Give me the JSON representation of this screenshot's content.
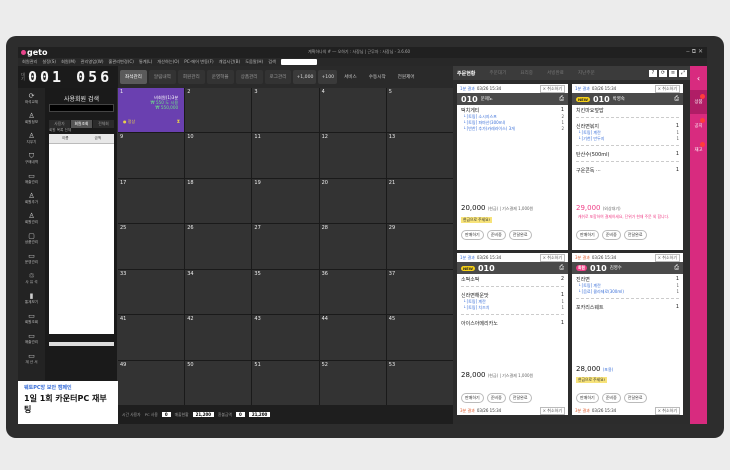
{
  "app": {
    "logo": "geto",
    "title": "계획하나의 # ― 오하기 : 사장님 | 근무자 : 사장님 - 3.6.60",
    "window_controls": "‒ ⧉ ✕"
  },
  "menu": [
    "회원관리",
    "설정(S)",
    "회원(M)",
    "관리영업(W)",
    "홀관리변경(C)",
    "통계(L)",
    "개산하는(O)",
    "PC-에어 변동(F)",
    "개업시간(B)",
    "도움말(H)",
    "검색"
  ],
  "counter": {
    "label": "대기",
    "value": "001 056"
  },
  "toolbar": {
    "tabs": [
      "좌석관리",
      "알림내역",
      "회원관리",
      "운영혁율",
      "상품관리",
      "로그관리"
    ],
    "buttons": [
      "+1,000",
      "+100",
      "서비스",
      "수동시작",
      "전원제어"
    ]
  },
  "nav": [
    {
      "label": "좌석교체",
      "icon": "⟳"
    },
    {
      "label": "회원정보",
      "icon": "♙"
    },
    {
      "label": "지우기",
      "icon": "♙"
    },
    {
      "label": "구매내역",
      "icon": "⛉"
    },
    {
      "label": "매출관리",
      "icon": "▭"
    },
    {
      "label": "회원추가",
      "icon": "♙"
    },
    {
      "label": "회원관리",
      "icon": "♙"
    },
    {
      "label": "상품관리",
      "icon": "▢"
    },
    {
      "label": "운영관리",
      "icon": "▭"
    },
    {
      "label": "사 유 석",
      "icon": "♲"
    },
    {
      "label": "통계보기",
      "icon": "▮"
    },
    {
      "label": "회원조회",
      "icon": "▭"
    },
    {
      "label": "매출관리",
      "icon": "▭"
    },
    {
      "label": "계 산 서",
      "icon": "▭"
    },
    {
      "label": "환경설정",
      "icon": "☼"
    }
  ],
  "member": {
    "title": "사용회원 검색",
    "tabs": [
      "사용자",
      "회원조회",
      "전체회"
    ],
    "sub": "회원 목록 전체",
    "columns": [
      "이름",
      "금액"
    ]
  },
  "promo": {
    "top": "웨토PC방 보안 캠페인",
    "main": "1일 1회 카운터PC 재부팅"
  },
  "grid": {
    "active": {
      "num": "1",
      "lines": [
        "비회원(1)3분",
        "₩ 550 도 시용",
        "₩ 550,000"
      ],
      "footer_left": "● 정상",
      "footer_right": "⧗"
    },
    "cells": [
      "2",
      "3",
      "4",
      "5",
      "9",
      "10",
      "11",
      "12",
      "13",
      "17",
      "18",
      "19",
      "20",
      "21",
      "25",
      "26",
      "27",
      "28",
      "29",
      "33",
      "34",
      "35",
      "36",
      "37",
      "41",
      "42",
      "43",
      "44",
      "45",
      "49",
      "50",
      "51",
      "52",
      "53"
    ]
  },
  "status": {
    "labels": [
      "시간 사용자",
      "PC 사용",
      "",
      "매출현황",
      "",
      "환불금액",
      ""
    ],
    "values": [
      "0",
      "21,200",
      "0",
      "21,200"
    ]
  },
  "orders": {
    "title": "주문현황",
    "tabs": [
      "주문대기",
      "요리중",
      "서빙완료",
      "지난주문"
    ],
    "cards": [
      {
        "no": "1분 결과",
        "time": "03/26 15:34",
        "cancel": "× 취소하기",
        "seat": "010",
        "nick": "문제노",
        "items": [
          {
            "name": "떡치게티",
            "qty": "1",
            "opts": [
              [
                "└ [토핑] 소시지스프",
                "2"
              ],
              [
                "└ [토핑] 파마산(300ml)",
                "1"
              ],
              [
                "└ [반찬] 추가(카레라이스) 3개",
                "2"
              ]
            ]
          }
        ],
        "total": "20,000",
        "total_sub": "(현금) | 기스결제 1,000원",
        "pay": "현금으로 주세요!",
        "btns": [
          "판매하기",
          "준비중",
          "전달완료"
        ]
      },
      {
        "no": "1분 결과",
        "time": "03/26 15:34",
        "cancel": "× 취소하기",
        "badge": "NEW",
        "seat": "010",
        "nick": "박영숙",
        "sub": "주문 이미보기",
        "items": [
          {
            "name": "치킨마요덮밥",
            "qty": "",
            "opts": []
          },
          {
            "name": "신라면볶지",
            "qty": "1",
            "opts": [
              [
                "└ [토핑] 계란",
                "1"
              ],
              [
                "└ [기천] 만두지",
                "1"
              ]
            ]
          },
          {
            "name": "탄산수(500ml)",
            "qty": "1",
            "opts": []
          },
          {
            "name": "구운콘독 ···",
            "qty": "1",
            "opts": []
          }
        ],
        "total": "29,000",
        "total_sub": "(외상대기)",
        "pay": "캐쉬로 포함하여 결제하세요, 단위가 현재 주문 외 합니다.",
        "btns": [
          "판매하기",
          "준비중",
          "전달완료"
        ]
      },
      {
        "no": "1분 결과",
        "time": "03/26 15:34",
        "cancel": "× 취소하기",
        "badge": "NEW",
        "seat": "010",
        "nick": "",
        "items": [
          {
            "name": "소떡소떡",
            "qty": "2",
            "opts": []
          },
          {
            "name": "신라면해운맛",
            "qty": "1",
            "opts": [
              [
                "└ [토핑] 계란",
                "1"
              ],
              [
                "└ [토핑] 치즈치",
                "1"
              ]
            ]
          },
          {
            "name": "아이스아메리카노",
            "qty": "1",
            "opts": []
          }
        ],
        "total": "28,000",
        "total_sub": "(현금) | 기스결제 1,000원",
        "btns": [
          "판매하기",
          "준비중",
          "전달완료"
        ]
      },
      {
        "no": "3분 결과",
        "time": "03/26 15:34",
        "cancel": "× 취소하기",
        "badge": "회원",
        "seat": "010",
        "nick": "김영수",
        "items": [
          {
            "name": "진라면",
            "qty": "1",
            "opts": [
              [
                "└ [토핑] 계란",
                "1"
              ],
              [
                "└ [음료] 콜라제로(300ml)",
                "1"
              ]
            ]
          },
          {
            "name": "포카리스웨트",
            "qty": "1",
            "opts": []
          }
        ],
        "total": "28,000",
        "total_sub": "(포용)",
        "pay": "현금으로 주세요!",
        "btns": [
          "판매하기",
          "준비중",
          "전달완료"
        ]
      }
    ],
    "more": [
      {
        "no": "3분 결과",
        "time": "03/26 15:34",
        "cancel": "× 취소하기"
      },
      {
        "no": "3분 결과",
        "time": "03/26 15:34",
        "cancel": "× 취소하기"
      }
    ]
  },
  "side": [
    "상품",
    "공지",
    "재고"
  ]
}
